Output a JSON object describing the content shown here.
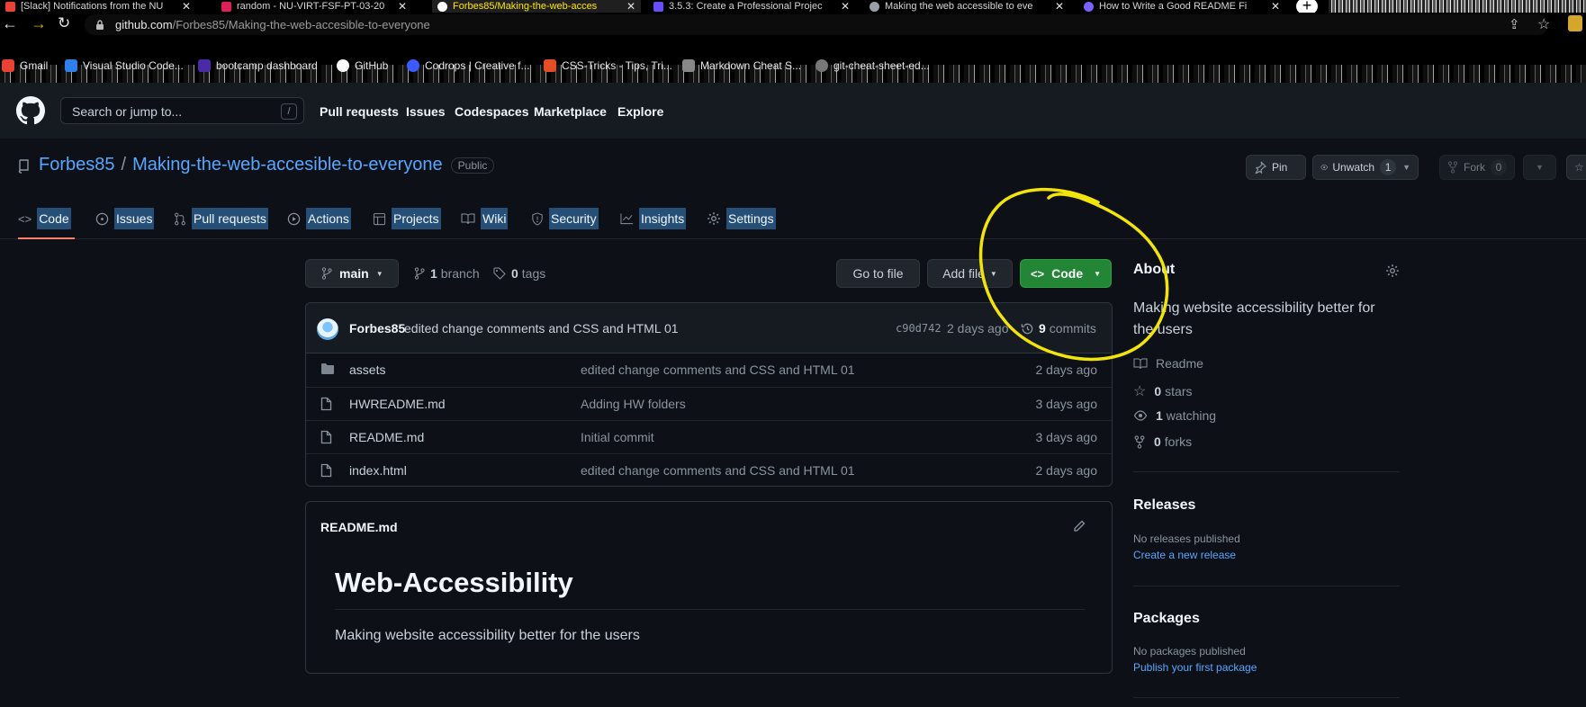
{
  "browser": {
    "tabs": [
      {
        "title": "[Slack] Notifications from the NU",
        "favicon_color": "#ea4335",
        "active": false
      },
      {
        "title": "random - NU-VIRT-FSF-PT-03-20",
        "favicon_color": "#e01e5a",
        "active": false
      },
      {
        "title": "Forbes85/Making-the-web-acces",
        "favicon_color": "#ffffff",
        "active": true
      },
      {
        "title": "3.5.3: Create a Professional Projec",
        "favicon_color": "#6a4cff",
        "active": false
      },
      {
        "title": "Making the web accessible to eve",
        "favicon_color": "#9aa0a6",
        "active": false
      },
      {
        "title": "How to Write a Good README Fi",
        "favicon_color": "#7b61ff",
        "active": false
      }
    ],
    "new_tab_label": "+",
    "address": {
      "domain": "github.com",
      "path": "/Forbes85/Making-the-web-accesible-to-everyone"
    },
    "bookmarks": [
      {
        "label": "Gmail",
        "icon_color": "#ea4335"
      },
      {
        "label": "Visual Studio Code...",
        "icon_color": "#2f80ed"
      },
      {
        "label": "bootcamp dashboard",
        "icon_color": "#4b2aa6"
      },
      {
        "label": "GitHub",
        "icon_color": "#ffffff"
      },
      {
        "label": "Codrops | Creative f...",
        "icon_color": "#3d5afe"
      },
      {
        "label": "CSS-Tricks - Tips, Tri...",
        "icon_color": "#e44d26"
      },
      {
        "label": "Markdown Cheat S...",
        "icon_color": "#888888"
      },
      {
        "label": "git-cheat-sheet-ed...",
        "icon_color": "#777777"
      }
    ]
  },
  "github_header": {
    "search_placeholder": "Search or jump to...",
    "search_shortcut": "/",
    "nav": [
      "Pull requests",
      "Issues",
      "Codespaces",
      "Marketplace",
      "Explore"
    ]
  },
  "repo": {
    "owner": "Forbes85",
    "separator": "/",
    "name": "Making-the-web-accesible-to-everyone",
    "visibility": "Public",
    "pin_label": "Pin",
    "unwatch_label": "Unwatch",
    "watch_count": "1",
    "fork_label": "Fork",
    "fork_count": "0"
  },
  "repo_tabs": [
    {
      "label": "Code",
      "icon": "code-icon"
    },
    {
      "label": "Issues",
      "icon": "issue-icon"
    },
    {
      "label": "Pull requests",
      "icon": "pull-request-icon"
    },
    {
      "label": "Actions",
      "icon": "play-icon"
    },
    {
      "label": "Projects",
      "icon": "table-icon"
    },
    {
      "label": "Wiki",
      "icon": "book-icon"
    },
    {
      "label": "Security",
      "icon": "shield-icon"
    },
    {
      "label": "Insights",
      "icon": "graph-icon"
    },
    {
      "label": "Settings",
      "icon": "gear-icon"
    }
  ],
  "toolbar": {
    "branch": "main",
    "branch_count": "1",
    "branch_word": "branch",
    "tag_count": "0",
    "tag_word": "tags",
    "go_to_file": "Go to file",
    "add_file": "Add file",
    "code_button": "Code"
  },
  "latest_commit": {
    "author": "Forbes85",
    "message": "edited change comments and CSS and HTML 01",
    "sha": "c90d742",
    "age": "2 days ago",
    "commit_count": "9",
    "commit_word": "commits"
  },
  "files": [
    {
      "name": "assets",
      "type": "folder",
      "message": "edited change comments and CSS and HTML 01",
      "age": "2 days ago"
    },
    {
      "name": "HWREADME.md",
      "type": "file",
      "message": "Adding HW folders",
      "age": "3 days ago"
    },
    {
      "name": "README.md",
      "type": "file",
      "message": "Initial commit",
      "age": "3 days ago"
    },
    {
      "name": "index.html",
      "type": "file",
      "message": "edited change comments and CSS and HTML 01",
      "age": "2 days ago"
    }
  ],
  "readme": {
    "filename": "README.md",
    "heading": "Web-Accessibility",
    "body": "Making website accessibility better for the users"
  },
  "about": {
    "heading": "About",
    "description": "Making website accessibility better for the users",
    "readme_label": "Readme",
    "stars_count": "0",
    "stars_word": "stars",
    "watching_count": "1",
    "watching_word": "watching",
    "forks_count": "0",
    "forks_word": "forks"
  },
  "releases": {
    "heading": "Releases",
    "status": "No releases published",
    "link": "Create a new release"
  },
  "packages": {
    "heading": "Packages",
    "status": "No packages published",
    "link": "Publish your first package"
  },
  "colors": {
    "accent_link": "#58a6ff",
    "code_button": "#238636",
    "selected_tab_underline": "#f78166",
    "annotation_circle": "#f2e40b"
  }
}
